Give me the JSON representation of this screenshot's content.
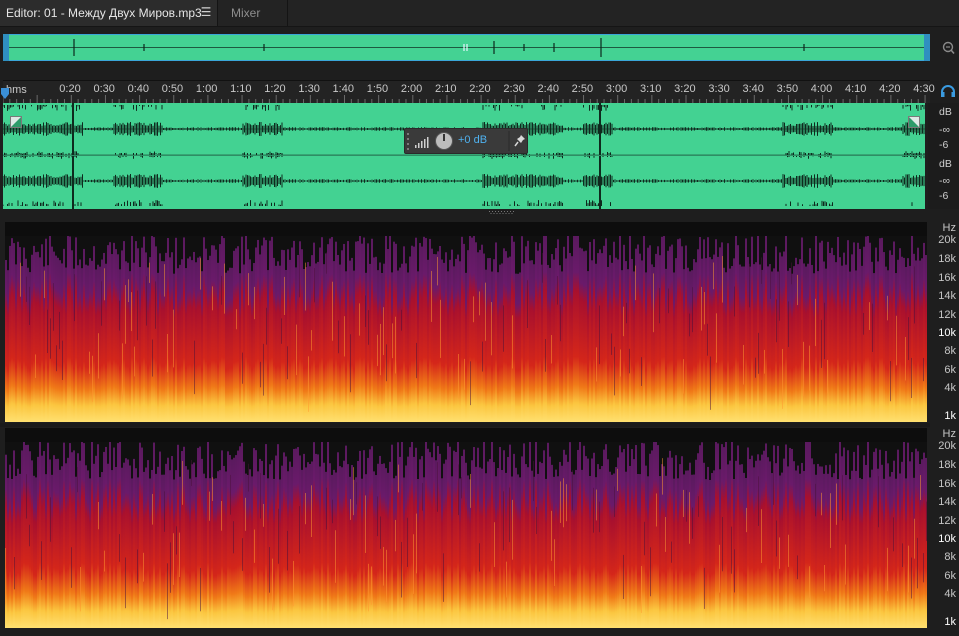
{
  "tabs": [
    {
      "label": "Editor: 01 - Между Двух Миров.mp3",
      "active": true
    },
    {
      "label": "Mixer",
      "active": false
    }
  ],
  "tab_menu_icon": "hamburger-icon",
  "colors": {
    "waveform": "#43d292",
    "selection_border": "#3aa6d8",
    "gain_text": "#4fb1ef",
    "panel_bg": "#1e1e1e"
  },
  "ruler": {
    "unit": "hms",
    "ticks": [
      "0:20",
      "0:30",
      "0:40",
      "0:50",
      "1:00",
      "1:10",
      "1:20",
      "1:30",
      "1:40",
      "1:50",
      "2:00",
      "2:10",
      "2:20",
      "2:30",
      "2:40",
      "2:50",
      "3:00",
      "3:10",
      "3:20",
      "3:30",
      "3:40",
      "3:50",
      "4:00",
      "4:10",
      "4:20",
      "4:30"
    ]
  },
  "hud": {
    "gain_label": "+0 dB"
  },
  "amplitude_scale": {
    "channel1": [
      "dB",
      "-∞",
      "-6"
    ],
    "channel2": [
      "dB",
      "-∞",
      "-6"
    ]
  },
  "frequency_scale": {
    "unit": "Hz",
    "labels": [
      "20k",
      "18k",
      "16k",
      "14k",
      "12k",
      "10k",
      "8k",
      "6k",
      "4k",
      "1k"
    ],
    "bold": [
      "10k",
      "1k"
    ]
  }
}
